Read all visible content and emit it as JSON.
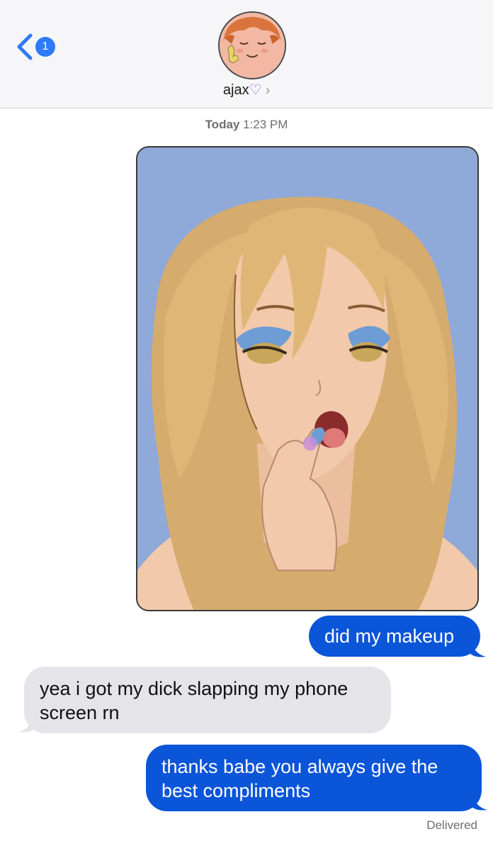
{
  "header": {
    "unread_count": "1",
    "contact_name": "ajax",
    "contact_heart": "♡",
    "contact_chevron": "›"
  },
  "thread": {
    "timestamp_day": "Today",
    "timestamp_time": "1:23 PM",
    "messages": [
      {
        "direction": "outgoing",
        "type": "image"
      },
      {
        "direction": "outgoing",
        "text": "did my makeup"
      },
      {
        "direction": "incoming",
        "text": "yea i got my dick slapping my phone screen rn"
      },
      {
        "direction": "outgoing",
        "text": "thanks babe you always give the best compliments"
      }
    ],
    "status": "Delivered"
  },
  "colors": {
    "accent": "#2f7af6",
    "outgoing_bubble": "#0b55d8",
    "incoming_bubble": "#e4e4e9",
    "header_bg": "#f6f6f8",
    "image_bg": "#8fa9d8"
  },
  "icons": {
    "back": "chevron-left-icon",
    "contact_chevron": "chevron-right-icon"
  }
}
